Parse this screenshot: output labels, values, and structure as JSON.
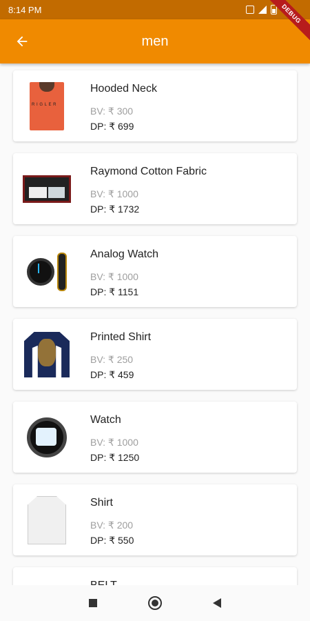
{
  "status_bar": {
    "time": "8:14 PM",
    "icons": [
      "sim-icon",
      "signal-icon",
      "battery-icon"
    ],
    "debug_banner": "DEBUG"
  },
  "app_bar": {
    "title": "men",
    "back_icon": "arrow-back-icon",
    "background_color": "#f08a00",
    "status_bar_color": "#c26b00"
  },
  "products": [
    {
      "name": " Hooded Neck",
      "bv": "BV: ₹ 300",
      "dp": "DP: ₹ 699",
      "image_icon": "hoodie-image"
    },
    {
      "name": "Raymond Cotton Fabric",
      "bv": "BV: ₹ 1000",
      "dp": "DP: ₹ 1732",
      "image_icon": "fabric-box-image"
    },
    {
      "name": "Analog Watch",
      "bv": "BV: ₹ 1000",
      "dp": "DP: ₹ 1151",
      "image_icon": "watch-image"
    },
    {
      "name": "Printed Shirt",
      "bv": "BV: ₹ 250",
      "dp": "DP: ₹ 459",
      "image_icon": "printed-shirt-image"
    },
    {
      "name": "Watch",
      "bv": "BV: ₹ 1000",
      "dp": "DP: ₹ 1250",
      "image_icon": "watch-image"
    },
    {
      "name": "Shirt",
      "bv": "BV: ₹ 200",
      "dp": "DP: ₹ 550",
      "image_icon": "white-shirt-image"
    },
    {
      "name": "BELT",
      "bv": "",
      "dp": "",
      "image_icon": "belt-image"
    }
  ],
  "nav_bar": {
    "icons": [
      "recent-apps-icon",
      "home-icon",
      "back-icon"
    ]
  }
}
